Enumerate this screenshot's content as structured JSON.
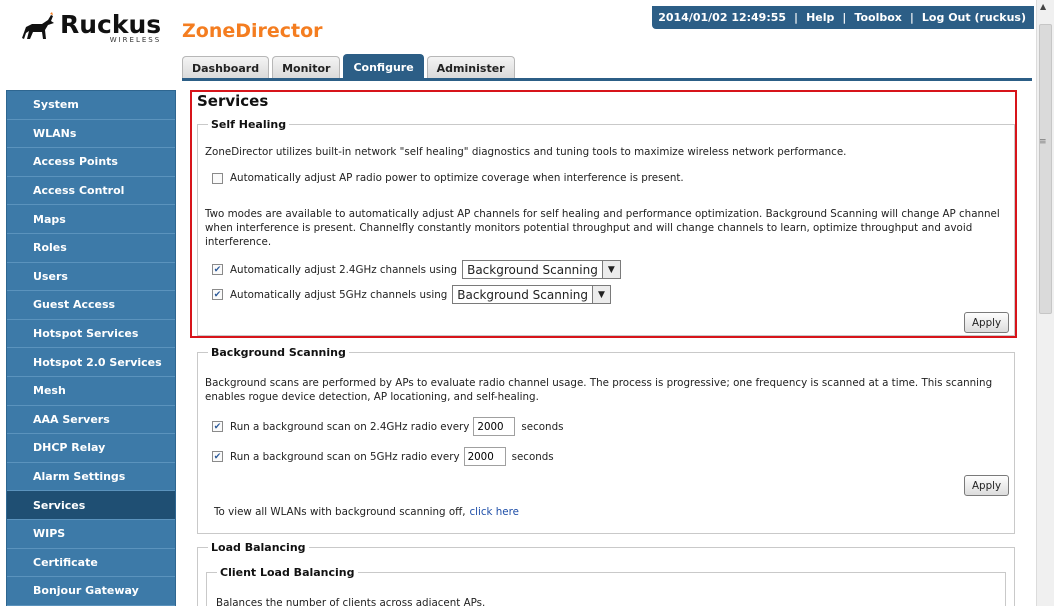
{
  "brand": {
    "name": "Ruckus",
    "tagline": "WIRELESS",
    "product": "ZoneDirector"
  },
  "topbar": {
    "datetime": "2014/01/02 12:49:55",
    "help": "Help",
    "toolbox": "Toolbox",
    "logout": "Log Out (ruckus)"
  },
  "tabs": [
    "Dashboard",
    "Monitor",
    "Configure",
    "Administer"
  ],
  "active_tab": "Configure",
  "sidebar": [
    "System",
    "WLANs",
    "Access Points",
    "Access Control",
    "Maps",
    "Roles",
    "Users",
    "Guest Access",
    "Hotspot Services",
    "Hotspot 2.0 Services",
    "Mesh",
    "AAA Servers",
    "DHCP Relay",
    "Alarm Settings",
    "Services",
    "WIPS",
    "Certificate",
    "Bonjour Gateway"
  ],
  "active_sidebar": "Services",
  "page": {
    "title": "Services",
    "self_healing": {
      "legend": "Self Healing",
      "intro": "ZoneDirector utilizes built-in network \"self healing\" diagnostics and tuning tools to maximize wireless network performance.",
      "power_label": "Automatically adjust AP radio power to optimize coverage when interference is present.",
      "power_checked": false,
      "modes_text": "Two modes are available to automatically adjust AP channels for self healing and performance optimization. Background Scanning will change AP channel when interference is present. Channelfly constantly monitors potential throughput and will change channels to learn, optimize throughput and avoid interference.",
      "ch24_label": "Automatically adjust 2.4GHz channels using",
      "ch24_value": "Background Scanning",
      "ch24_checked": true,
      "ch5_label": "Automatically adjust 5GHz channels using",
      "ch5_value": "Background Scanning",
      "ch5_checked": true,
      "apply": "Apply"
    },
    "background_scanning": {
      "legend": "Background Scanning",
      "desc": "Background scans are performed by APs to evaluate radio channel usage. The process is progressive; one frequency is scanned at a time. This scanning enables rogue device detection, AP locationing, and self-healing.",
      "r24_label": "Run a background scan on 2.4GHz radio every",
      "r24_value": "2000",
      "r24_checked": true,
      "r5_label": "Run a background scan on 5GHz radio every",
      "r5_value": "2000",
      "r5_checked": true,
      "seconds": "seconds",
      "apply": "Apply",
      "footer_text": "To view all WLANs with background scanning off,",
      "footer_link": "click here"
    },
    "load_balancing": {
      "legend": "Load Balancing",
      "client_legend": "Client Load Balancing",
      "client_desc": "Balances the number of clients across adjacent APs."
    }
  },
  "colors": {
    "accent": "#2c5e86",
    "sidebar": "#3d7aa8",
    "product": "#f47d20",
    "highlight": "#d7141a"
  }
}
